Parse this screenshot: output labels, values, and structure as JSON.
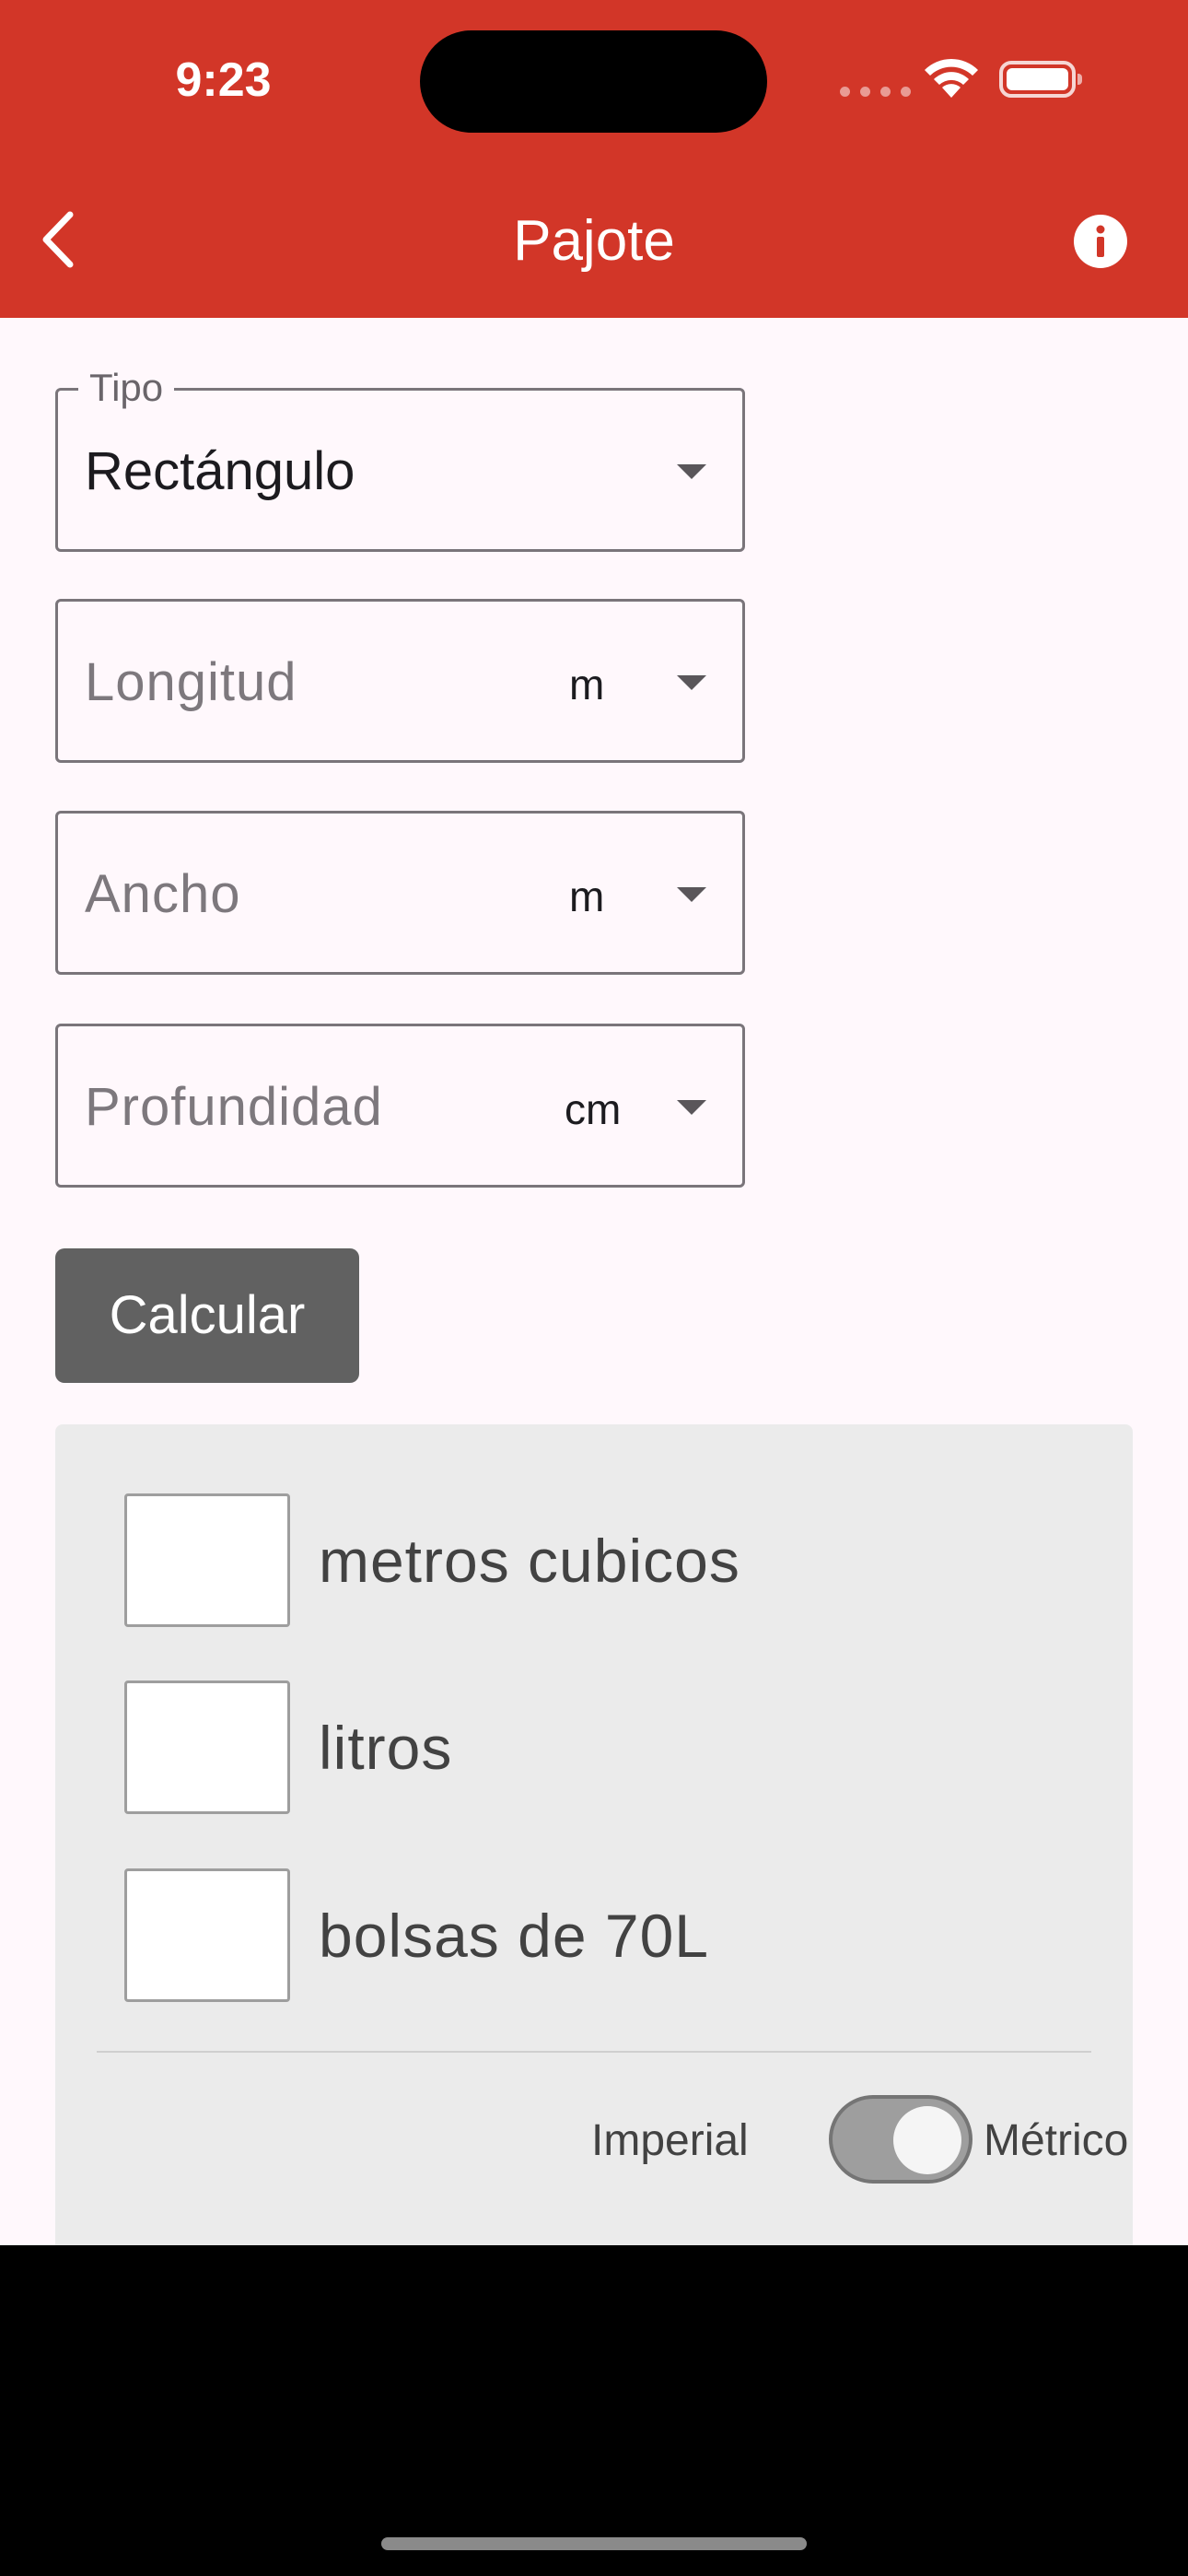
{
  "status_bar": {
    "time": "9:23"
  },
  "app_bar": {
    "title": "Pajote",
    "back_icon": "chevron-left-icon",
    "info_icon": "info-icon"
  },
  "form": {
    "tipo": {
      "label": "Tipo",
      "value": "Rectángulo"
    },
    "longitud": {
      "placeholder": "Longitud",
      "unit": "m"
    },
    "ancho": {
      "placeholder": "Ancho",
      "unit": "m"
    },
    "profundidad": {
      "placeholder": "Profundidad",
      "unit": "cm"
    },
    "calcular_label": "Calcular"
  },
  "results": {
    "items": [
      {
        "label": "metros cubicos"
      },
      {
        "label": "litros"
      },
      {
        "label": "bolsas de 70L"
      }
    ],
    "unit_toggle": {
      "left_label": "Imperial",
      "right_label": "Métrico",
      "selected": "Métrico"
    }
  },
  "colors": {
    "accent": "#d23628",
    "button": "#616161",
    "panel": "#ebebeb",
    "background": "#fff8fc"
  }
}
